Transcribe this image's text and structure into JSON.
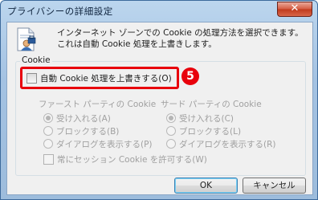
{
  "window": {
    "title": "プライバシーの詳細設定",
    "close_glyph": "✕"
  },
  "intro_text": "インターネット ゾーンでの Cookie の処理方法を選択できます。これは自動 Cookie 処理を上書きします。",
  "group_label": "Cookie",
  "override": {
    "label": "自動 Cookie 処理を上書きする(O)",
    "checked": false
  },
  "callout_number": "5",
  "first_party": {
    "heading": "ファースト パーティの Cookie",
    "options": [
      {
        "label": "受け入れる(A)",
        "selected": true
      },
      {
        "label": "ブロックする(B)",
        "selected": false
      },
      {
        "label": "ダイアログを表示する(P)",
        "selected": false
      }
    ]
  },
  "third_party": {
    "heading": "サード パーティの Cookie",
    "options": [
      {
        "label": "受け入れる(C)",
        "selected": true
      },
      {
        "label": "ブロックする(L)",
        "selected": false
      },
      {
        "label": "ダイアログを表示する(R)",
        "selected": false
      }
    ]
  },
  "session_cookie": {
    "label": "常にセッション Cookie を許可する(W)",
    "checked": false
  },
  "buttons": {
    "ok": "OK",
    "cancel": "キャンセル"
  },
  "colors": {
    "callout_red": "#e8000c",
    "titlebar_blue": "#a4c2e2",
    "disabled_text": "#a0a0a0"
  },
  "icons": [
    "privacy-document-icon",
    "close-icon"
  ]
}
